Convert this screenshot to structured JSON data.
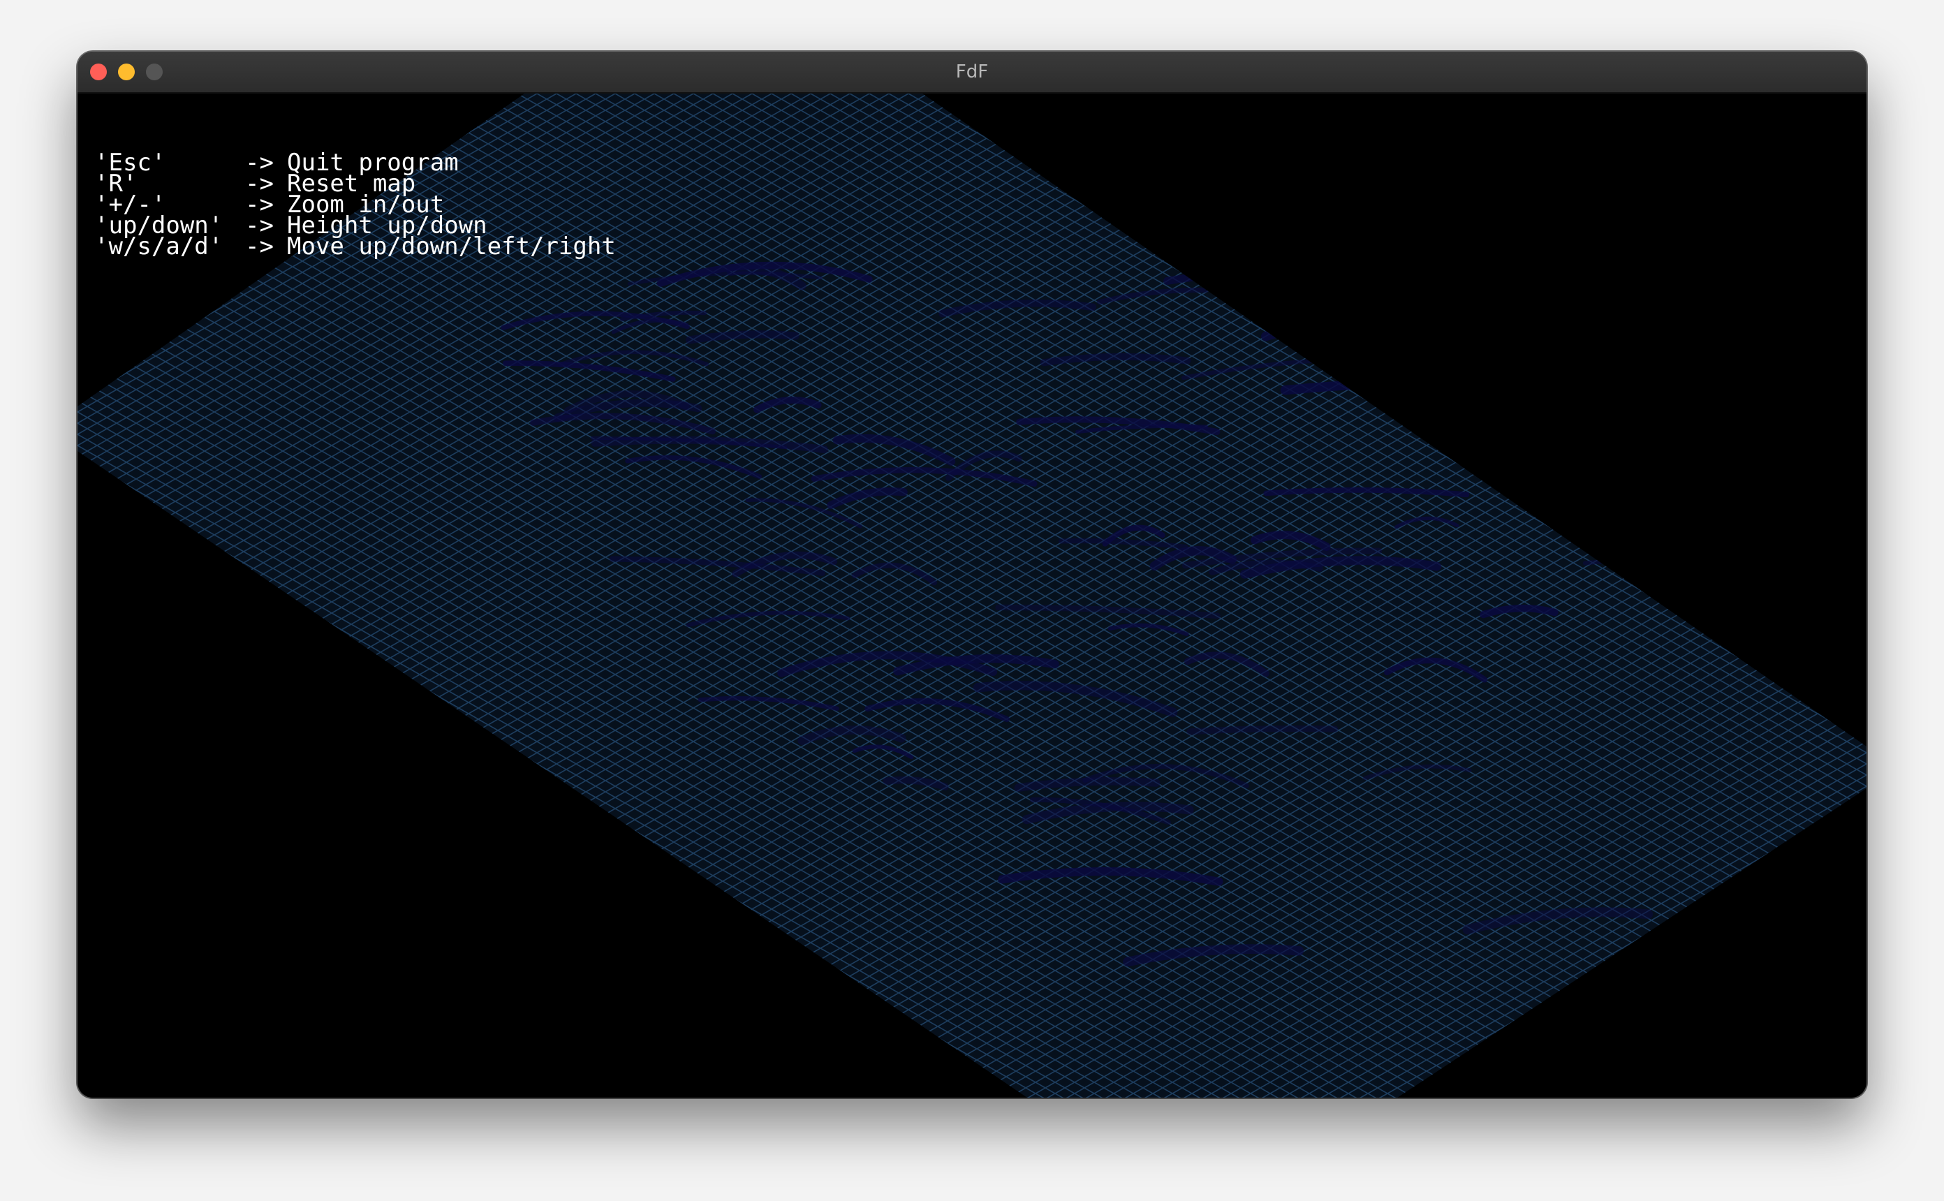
{
  "window": {
    "title": "FdF",
    "controls": [
      "close",
      "minimize",
      "maximize"
    ]
  },
  "help": [
    {
      "key": "'Esc'",
      "arrow": "->",
      "action": "Quit program"
    },
    {
      "key": "'R'",
      "arrow": "->",
      "action": "Reset map"
    },
    {
      "key": "'+/-'",
      "arrow": "->",
      "action": "Zoom in/out"
    },
    {
      "key": "'up/down'",
      "arrow": "->",
      "action": "Height up/down"
    },
    {
      "key": "'w/s/a/d'",
      "arrow": "->",
      "action": "Move up/down/left/right"
    }
  ],
  "map": {
    "projection": "isometric",
    "grid_color": "#1b3a5c",
    "ridge_color": "#0a0a40",
    "background": "#000000"
  }
}
